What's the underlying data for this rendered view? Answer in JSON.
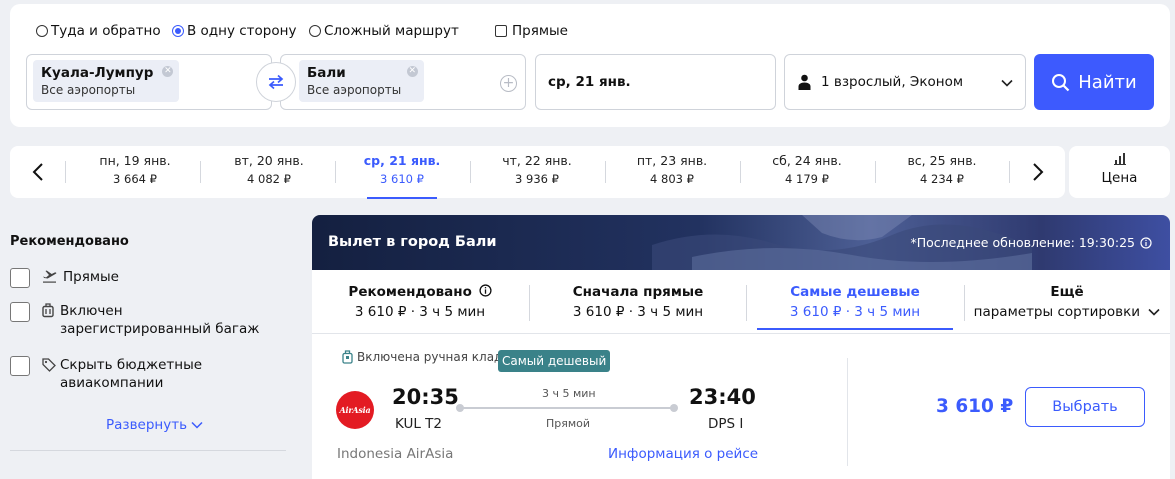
{
  "trip_type": {
    "options": [
      {
        "label": "Туда и обратно",
        "selected": false
      },
      {
        "label": "В одну сторону",
        "selected": true
      },
      {
        "label": "Сложный маршрут",
        "selected": false
      }
    ],
    "direct_only": {
      "label": "Прямые",
      "checked": false
    }
  },
  "search": {
    "origin": {
      "city": "Куала-Лумпур",
      "sub": "Все аэропорты"
    },
    "destination": {
      "city": "Бали",
      "sub": "Все аэропорты"
    },
    "date": "ср, 21 янв.",
    "passengers": "1 взрослый, Эконом",
    "find_label": "Найти"
  },
  "date_strip": {
    "days": [
      {
        "label": "пн, 19 янв.",
        "price": "3 664 ₽",
        "active": false
      },
      {
        "label": "вт, 20 янв.",
        "price": "4 082 ₽",
        "active": false
      },
      {
        "label": "ср, 21 янв.",
        "price": "3 610 ₽",
        "active": true
      },
      {
        "label": "чт, 22 янв.",
        "price": "3 936 ₽",
        "active": false
      },
      {
        "label": "пт, 23 янв.",
        "price": "4 803 ₽",
        "active": false
      },
      {
        "label": "сб, 24 янв.",
        "price": "4 179 ₽",
        "active": false
      },
      {
        "label": "вс, 25 янв.",
        "price": "4 234 ₽",
        "active": false
      }
    ],
    "price_chart_label": "Цена"
  },
  "filters": {
    "title": "Рекомендовано",
    "items": [
      {
        "label": "Прямые",
        "checked": false
      },
      {
        "label": "Включен зарегистрированный багаж",
        "checked": false
      },
      {
        "label": "Скрыть бюджетные авиакомпании",
        "checked": false
      }
    ],
    "expand_label": "Развернуть"
  },
  "results": {
    "banner_title": "Вылет в город Бали",
    "last_update": "*Последнее обновление: 19:30:25",
    "sort_tabs": [
      {
        "title": "Рекомендовано",
        "value": "3 610 ₽ · 3 ч 5 мин",
        "active": false,
        "info": true
      },
      {
        "title": "Сначала прямые",
        "value": "3 610 ₽ · 3 ч 5 мин",
        "active": false
      },
      {
        "title": "Самые дешевые",
        "value": "3 610 ₽ · 3 ч 5 мин",
        "active": true
      },
      {
        "title": "Ещё",
        "value": "параметры сортировки",
        "active": false,
        "dropdown": true
      }
    ]
  },
  "flight": {
    "baggage_tag": "Включена ручная кладь",
    "cheapest_tag": "Самый дешевый",
    "airline_logo_text": "AirAsia",
    "departure_time": "20:35",
    "departure_airport": "KUL T2",
    "arrival_time": "23:40",
    "arrival_airport": "DPS I",
    "duration": "3 ч 5 мин",
    "stops": "Прямой",
    "airline": "Indonesia AirAsia",
    "info_link": "Информация о рейсе",
    "price": "3 610 ₽",
    "select_label": "Выбрать"
  },
  "colors": {
    "accent": "#3d5afe",
    "cheapest_badge": "#3a8289",
    "banner_dark": "#142040",
    "page_bg": "#eef0f4"
  }
}
